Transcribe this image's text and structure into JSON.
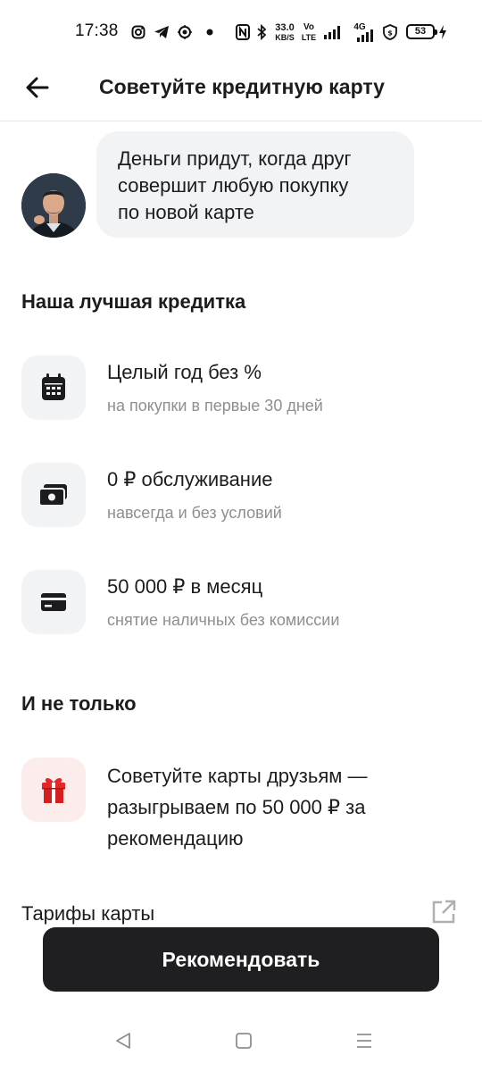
{
  "status_bar": {
    "time": "17:38",
    "net_speed_value": "33.0",
    "net_speed_unit": "KB/S",
    "volte_top": "Vo",
    "volte_bottom": "LTE",
    "network": "4G",
    "battery": "53",
    "icons": [
      "instagram-icon",
      "telegram-icon",
      "app-icon",
      "dot-icon",
      "nfc-icon",
      "bluetooth-icon",
      "signal-icon",
      "shield-icon",
      "battery-icon",
      "charging-icon"
    ]
  },
  "header": {
    "title": "Советуйте кредитную карту",
    "back_icon": "arrow-left-icon"
  },
  "message": {
    "text_line1": "Деньги придут, когда друг",
    "text_line2": "совершит любую покупку",
    "text_line3": "по новой карте"
  },
  "best_card": {
    "section_title": "Наша лучшая кредитка",
    "features": [
      {
        "icon": "calendar-icon",
        "title": "Целый год без %",
        "subtitle": "на покупки в первые 30 дней"
      },
      {
        "icon": "cash-icon",
        "title": "0 ₽ обслуживание",
        "subtitle": "навсегда и без условий"
      },
      {
        "icon": "card-icon",
        "title": "50 000 ₽ в месяц",
        "subtitle": "снятие наличных без комиссии"
      }
    ]
  },
  "more": {
    "section_title": "И не только",
    "promo_icon": "gift-icon",
    "promo_line1": "Советуйте карты друзьям —",
    "promo_line2": "разыгрываем по 50 000 ₽ за",
    "promo_line3": "рекомендацию"
  },
  "tariffs": {
    "label": "Тарифы карты",
    "icon": "external-link-icon"
  },
  "action": {
    "button_label": "Рекомендовать"
  },
  "nav": {
    "icons": [
      "back-triangle-icon",
      "home-square-icon",
      "recents-menu-icon"
    ]
  },
  "colors": {
    "button_bg": "#1f1f21",
    "icon_tile_bg": "#f2f3f5",
    "gift_tile_bg": "#fdecec",
    "gift_red": "#e52727",
    "secondary_text": "#8e8e93"
  }
}
